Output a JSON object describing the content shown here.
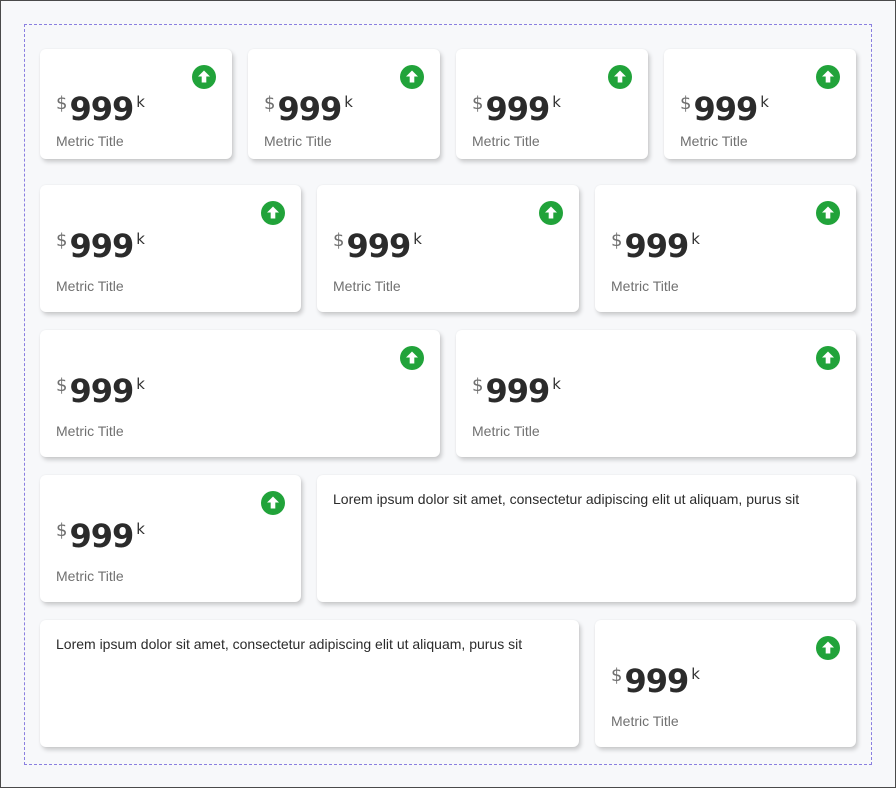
{
  "colors": {
    "accent": "#21a33a",
    "frame_border": "#8a7fe0"
  },
  "metric": {
    "currency": "$",
    "value": "999",
    "suffix": "k",
    "title": "Metric Title",
    "trend_icon": "arrow-up-circle-icon"
  },
  "lorem": "Lorem ipsum dolor sit amet, consectetur adipiscing elit ut aliquam, purus sit"
}
